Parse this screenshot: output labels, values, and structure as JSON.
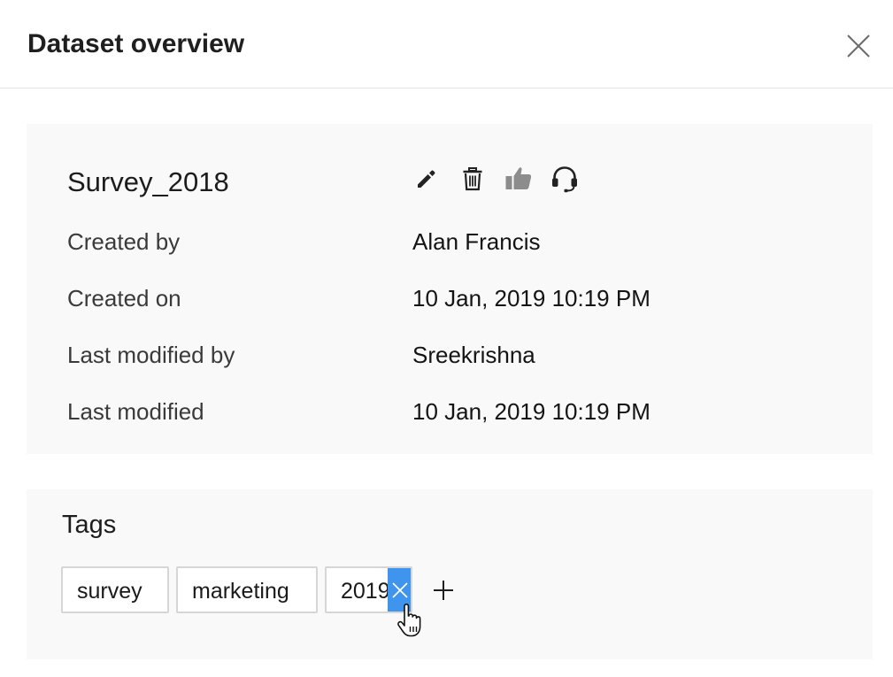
{
  "dialog": {
    "title": "Dataset overview",
    "close_icon": "close-icon"
  },
  "dataset": {
    "name": "Survey_2018",
    "actions": [
      {
        "name": "edit",
        "icon": "pencil-icon"
      },
      {
        "name": "delete",
        "icon": "trash-icon"
      },
      {
        "name": "like",
        "icon": "thumbs-up-icon"
      },
      {
        "name": "support",
        "icon": "headset-icon"
      }
    ],
    "details": [
      {
        "label": "Created by",
        "value": "Alan Francis"
      },
      {
        "label": "Created on",
        "value": "10 Jan, 2019 10:19 PM"
      },
      {
        "label": "Last modified by",
        "value": "Sreekrishna"
      },
      {
        "label": "Last modified",
        "value": "10 Jan, 2019 10:19 PM"
      }
    ]
  },
  "tags": {
    "title": "Tags",
    "items": [
      "survey",
      "marketing",
      "2019"
    ],
    "add_icon": "plus-icon",
    "remove_icon": "close-icon"
  },
  "colors": {
    "accent": "#3f94ee",
    "panel_bg": "#f9f9f9",
    "border": "#d6d6d6"
  }
}
